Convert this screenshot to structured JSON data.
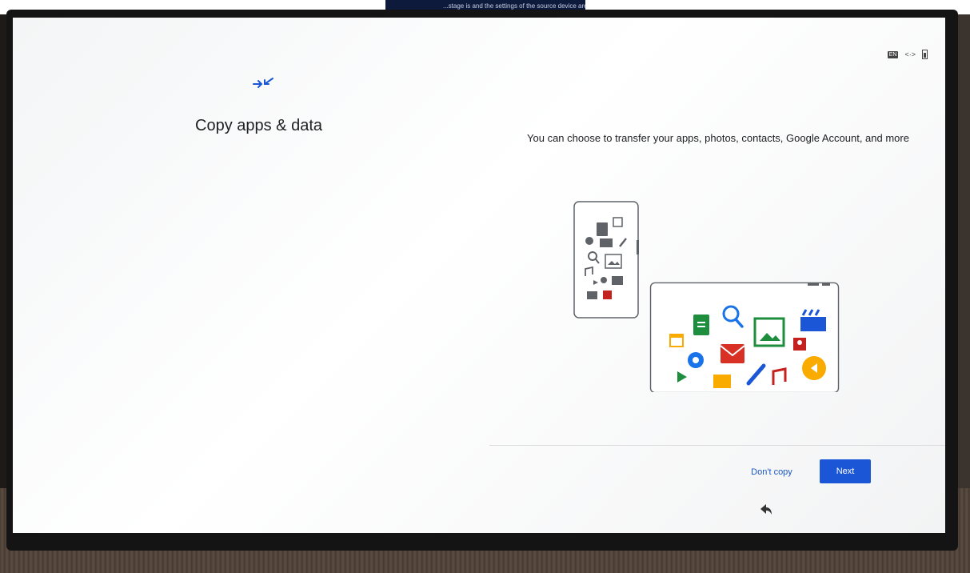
{
  "overlay": {
    "text": "...stage is and the settings of the source device are correct."
  },
  "status_bar": {
    "keyboard": "EN",
    "sync": "<·>",
    "icons": [
      "keyboard-indicator-icon",
      "sync-icon",
      "battery-icon"
    ]
  },
  "page": {
    "title": "Copy apps & data",
    "description": "You can choose to transfer your apps, photos, contacts, Google Account, and more",
    "hero_icon": "transfer-arrows-icon"
  },
  "illustration": {
    "name": "phone-to-tablet-transfer"
  },
  "actions": {
    "dont_copy_label": "Don't copy",
    "next_label": "Next"
  },
  "navigation": {
    "back_icon": "back-arrow-icon"
  },
  "colors": {
    "accent": "#1a56d6",
    "text": "#202124",
    "background": "#ffffff"
  }
}
